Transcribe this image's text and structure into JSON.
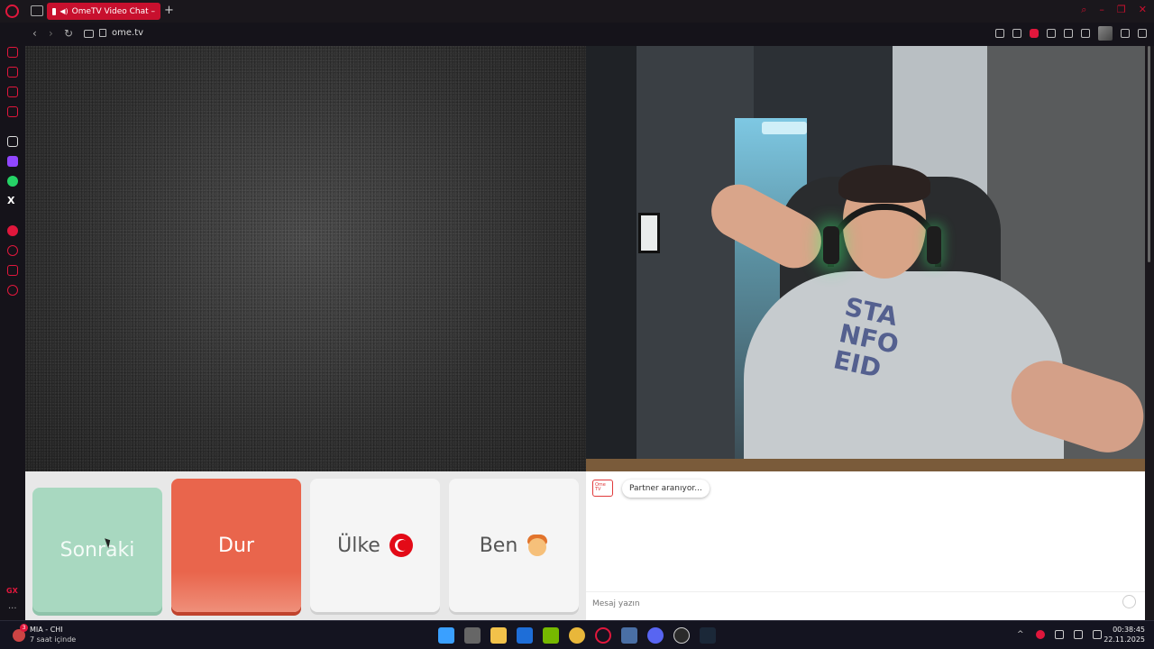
{
  "browser": {
    "tab_title": "OmeTV Video Chat –",
    "new_tab": "+",
    "url": "ome.tv"
  },
  "controls": {
    "next_label": "Sonraki",
    "stop_label": "Dur",
    "country_label": "Ülke",
    "me_label": "Ben"
  },
  "chat": {
    "logo_text": "Ome TV",
    "status_message": "Partner aranıyor...",
    "input_placeholder": "Mesaj yazın"
  },
  "partner_video": {
    "shirt_text": "STA NFO EID"
  },
  "taskbar": {
    "notification_badge": "3",
    "news_title": "MIA - CHI",
    "news_sub": "7 saat içinde",
    "time": "00:38:45",
    "date": "22.11.2025"
  },
  "colors": {
    "next": "#a8d8c0",
    "stop": "#e9654c",
    "browser_accent": "#c8102e"
  }
}
